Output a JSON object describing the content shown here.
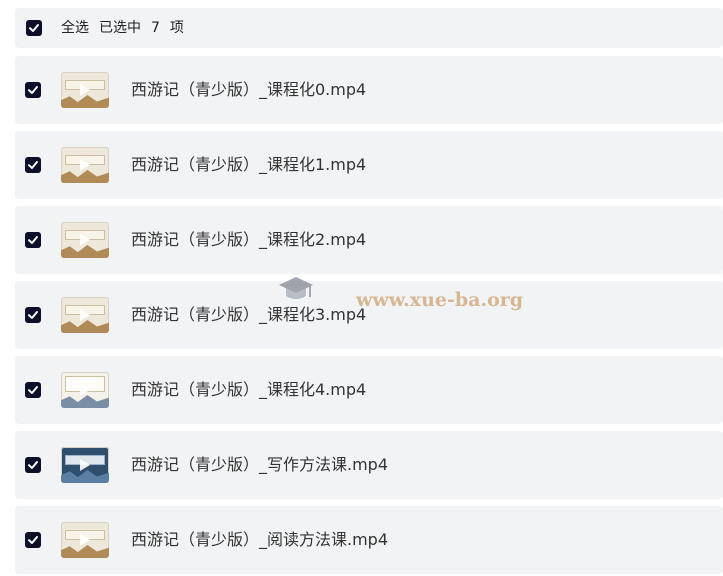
{
  "header": {
    "select_all": "全选",
    "selected_prefix": "已选中",
    "selected_count": "7",
    "selected_suffix": "项"
  },
  "files": [
    {
      "name": "西游记（青少版）_课程化0.mp4",
      "checked": true,
      "thumb_style": "title"
    },
    {
      "name": "西游记（青少版）_课程化1.mp4",
      "checked": true,
      "thumb_style": "title"
    },
    {
      "name": "西游记（青少版）_课程化2.mp4",
      "checked": true,
      "thumb_style": "title"
    },
    {
      "name": "西游记（青少版）_课程化3.mp4",
      "checked": true,
      "thumb_style": "title"
    },
    {
      "name": "西游记（青少版）_课程化4.mp4",
      "checked": true,
      "thumb_style": "text"
    },
    {
      "name": "西游记（青少版）_写作方法课.mp4",
      "checked": true,
      "thumb_style": "dark"
    },
    {
      "name": "西游记（青少版）_阅读方法课.mp4",
      "checked": true,
      "thumb_style": "title"
    }
  ],
  "watermark": {
    "text": "www.xue-ba.org"
  },
  "colors": {
    "checkbox": "#0b0f2a",
    "row_bg": "#f2f3f5"
  }
}
